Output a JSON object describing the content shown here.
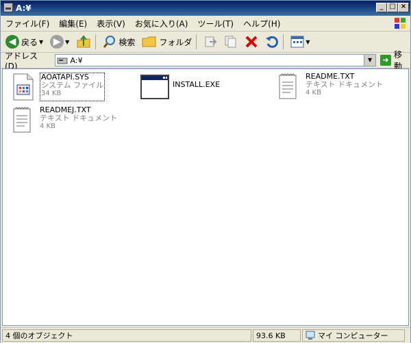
{
  "window": {
    "title": "A:¥"
  },
  "menu": {
    "items": [
      "ファイル(F)",
      "編集(E)",
      "表示(V)",
      "お気に入り(A)",
      "ツール(T)",
      "ヘルプ(H)"
    ]
  },
  "toolbar": {
    "back_label": "戻る",
    "search_label": "検索",
    "folders_label": "フォルダ"
  },
  "address": {
    "label": "アドレス(D)",
    "value": "A:¥",
    "go_label": "移動"
  },
  "files": [
    {
      "name": "AOATAPI.SYS",
      "type": "システム ファイル",
      "size": "34 KB",
      "icon": "system-file-icon"
    },
    {
      "name": "INSTALL.EXE",
      "type": "",
      "size": "",
      "icon": "application-window-icon"
    },
    {
      "name": "README.TXT",
      "type": "テキスト ドキュメント",
      "size": "4 KB",
      "icon": "text-document-icon"
    },
    {
      "name": "READMEJ.TXT",
      "type": "テキスト ドキュメント",
      "size": "4 KB",
      "icon": "text-document-icon"
    }
  ],
  "status": {
    "objects": "4 個のオブジェクト",
    "size": "93.6 KB",
    "location": "マイ コンピューター"
  },
  "colors": {
    "titlebar": "#0a246a",
    "accent_red": "#d60000",
    "go_green": "#2e9a2e"
  }
}
